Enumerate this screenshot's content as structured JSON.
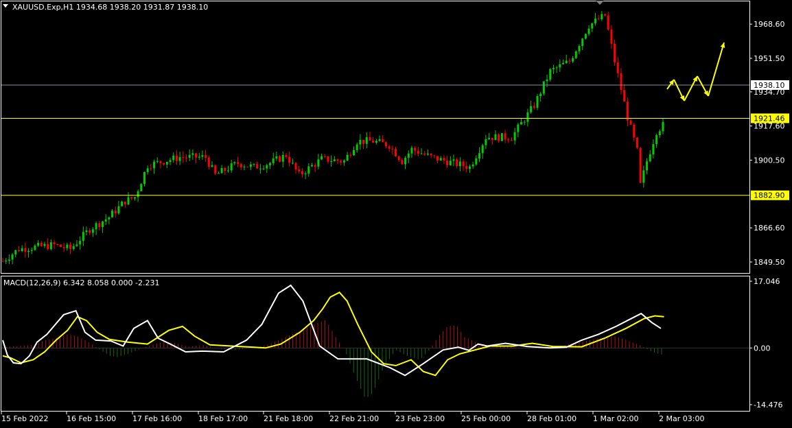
{
  "header": {
    "symbol_line": "XAUUSD.Exp,H1  1934.68 1938.20 1931.87 1938.10"
  },
  "indicator": {
    "label": "MACD(12,26,9) 6.342 8.058 0.000 -2.231"
  },
  "colors": {
    "background": "#000000",
    "frame": "#ffffff",
    "bull": "#00cc00",
    "bear": "#ff0000",
    "level": "#ffff00",
    "price_line": "#8090a0",
    "macd_line": "#ffffff",
    "signal_line": "#ffff00",
    "hist_pos": "#b01010",
    "hist_neg": "#0e6a0e",
    "arrow": "#ffff00"
  },
  "chart_data": {
    "type": "candlestick",
    "price_axis": {
      "ticks": [
        1968.6,
        1951.5,
        1934.7,
        1917.6,
        1900.5,
        1866.6,
        1849.5
      ],
      "tick_labels": [
        "1968.60",
        "1951.50",
        "1934.70",
        "1917.60",
        "1900.50",
        "1866.60",
        "1849.50"
      ],
      "range": [
        1844.0,
        1980.0
      ]
    },
    "current_price": {
      "value": 1938.1,
      "label": "1938.10"
    },
    "horizontal_levels": [
      {
        "value": 1921.46,
        "label": "1921.46"
      },
      {
        "value": 1882.9,
        "label": "1882.90"
      }
    ],
    "time_labels": [
      "15 Feb 2022",
      "16 Feb 15:00",
      "17 Feb 16:00",
      "18 Feb 17:00",
      "21 Feb 18:00",
      "22 Feb 21:00",
      "23 Feb 23:00",
      "25 Feb 00:00",
      "28 Feb 01:00",
      "1 Mar 02:00",
      "2 Mar 03:00"
    ],
    "bar_count": 206,
    "close_anchors": [
      [
        0,
        1850
      ],
      [
        5,
        1856
      ],
      [
        10,
        1857
      ],
      [
        16,
        1858
      ],
      [
        21,
        1856
      ],
      [
        27,
        1866
      ],
      [
        33,
        1872
      ],
      [
        38,
        1880
      ],
      [
        41,
        1882
      ],
      [
        45,
        1898
      ],
      [
        50,
        1900
      ],
      [
        55,
        1902
      ],
      [
        60,
        1902
      ],
      [
        63,
        1902
      ],
      [
        66,
        1893
      ],
      [
        73,
        1899
      ],
      [
        78,
        1897
      ],
      [
        83,
        1899
      ],
      [
        88,
        1903
      ],
      [
        92,
        1893
      ],
      [
        99,
        1901
      ],
      [
        106,
        1900
      ],
      [
        110,
        1910
      ],
      [
        115,
        1910
      ],
      [
        120,
        1908
      ],
      [
        124,
        1900
      ],
      [
        127,
        1906
      ],
      [
        133,
        1902
      ],
      [
        140,
        1899
      ],
      [
        145,
        1897
      ],
      [
        150,
        1912
      ],
      [
        158,
        1912
      ],
      [
        165,
        1928
      ],
      [
        170,
        1945
      ],
      [
        176,
        1950
      ],
      [
        182,
        1968
      ],
      [
        187,
        1973
      ],
      [
        190,
        1950
      ],
      [
        194,
        1922
      ],
      [
        197,
        1905
      ],
      [
        198,
        1888
      ],
      [
        200,
        1900
      ],
      [
        203,
        1915
      ],
      [
        205,
        1918
      ]
    ],
    "macd": {
      "range": [
        -14.476,
        17.046
      ],
      "tick_labels": [
        "17.046",
        "0.00",
        "-14.476"
      ],
      "main_points": [
        [
          0,
          2
        ],
        [
          6,
          -1.8
        ],
        [
          14,
          -3.8
        ],
        [
          24,
          -4
        ],
        [
          35,
          -2
        ],
        [
          45,
          1.5
        ],
        [
          58,
          3.5
        ],
        [
          80,
          8.5
        ],
        [
          96,
          9.5
        ],
        [
          108,
          4
        ],
        [
          122,
          2
        ],
        [
          142,
          1.8
        ],
        [
          158,
          0.5
        ],
        [
          172,
          5
        ],
        [
          190,
          7
        ],
        [
          204,
          2.5
        ],
        [
          220,
          1
        ],
        [
          240,
          -1
        ],
        [
          262,
          -0.8
        ],
        [
          290,
          -1
        ],
        [
          320,
          2
        ],
        [
          340,
          6
        ],
        [
          362,
          14
        ],
        [
          378,
          16
        ],
        [
          394,
          12
        ],
        [
          416,
          0.5
        ],
        [
          440,
          -2.8
        ],
        [
          478,
          -2.8
        ],
        [
          508,
          -5
        ],
        [
          528,
          -7
        ],
        [
          552,
          -4
        ],
        [
          578,
          -0.5
        ],
        [
          598,
          0.2
        ],
        [
          612,
          -0.6
        ],
        [
          624,
          1
        ],
        [
          636,
          0.5
        ],
        [
          660,
          1.2
        ],
        [
          688,
          0.4
        ],
        [
          718,
          0
        ],
        [
          740,
          0.2
        ],
        [
          760,
          2
        ],
        [
          782,
          3.5
        ],
        [
          805,
          5.5
        ],
        [
          822,
          7.2
        ],
        [
          838,
          8.8
        ],
        [
          852,
          6.5
        ],
        [
          864,
          5
        ]
      ],
      "signal_points": [
        [
          0,
          -2
        ],
        [
          10,
          -2.5
        ],
        [
          24,
          -3.8
        ],
        [
          40,
          -3
        ],
        [
          55,
          -1
        ],
        [
          70,
          2
        ],
        [
          85,
          4.5
        ],
        [
          98,
          8
        ],
        [
          110,
          7
        ],
        [
          124,
          4
        ],
        [
          140,
          2.2
        ],
        [
          164,
          1.5
        ],
        [
          190,
          1
        ],
        [
          218,
          4.5
        ],
        [
          236,
          5.5
        ],
        [
          252,
          3
        ],
        [
          272,
          0.8
        ],
        [
          300,
          0.5
        ],
        [
          330,
          0.2
        ],
        [
          345,
          0
        ],
        [
          365,
          1
        ],
        [
          390,
          4
        ],
        [
          408,
          7
        ],
        [
          420,
          10
        ],
        [
          430,
          13
        ],
        [
          442,
          14.2
        ],
        [
          452,
          12
        ],
        [
          466,
          6
        ],
        [
          484,
          -1
        ],
        [
          500,
          -4
        ],
        [
          516,
          -4.5
        ],
        [
          536,
          -3
        ],
        [
          552,
          -6
        ],
        [
          568,
          -7
        ],
        [
          584,
          -3
        ],
        [
          600,
          -1.5
        ],
        [
          620,
          -0.5
        ],
        [
          640,
          0.5
        ],
        [
          670,
          0.5
        ],
        [
          695,
          1.2
        ],
        [
          722,
          0.4
        ],
        [
          760,
          0.3
        ],
        [
          790,
          2.5
        ],
        [
          818,
          5
        ],
        [
          842,
          7.5
        ],
        [
          856,
          8.2
        ],
        [
          868,
          8
        ]
      ],
      "histogram_points": [
        [
          0,
          0.2
        ],
        [
          20,
          0.5
        ],
        [
          40,
          0.8
        ],
        [
          55,
          2
        ],
        [
          70,
          2.5
        ],
        [
          85,
          3.5
        ],
        [
          98,
          3
        ],
        [
          110,
          1.8
        ],
        [
          124,
          0
        ],
        [
          140,
          -2
        ],
        [
          150,
          -2.3
        ],
        [
          165,
          -1.5
        ],
        [
          180,
          -0.3
        ],
        [
          196,
          0.8
        ],
        [
          212,
          1.6
        ],
        [
          228,
          1.2
        ],
        [
          244,
          0.3
        ],
        [
          262,
          0.8
        ],
        [
          280,
          0
        ],
        [
          298,
          -0.6
        ],
        [
          320,
          -0.2
        ],
        [
          344,
          0.6
        ],
        [
          360,
          1.8
        ],
        [
          376,
          3.2
        ],
        [
          392,
          4.5
        ],
        [
          408,
          6
        ],
        [
          424,
          7.2
        ],
        [
          438,
          2.5
        ],
        [
          450,
          -1
        ],
        [
          462,
          -7
        ],
        [
          476,
          -13
        ],
        [
          486,
          -11.5
        ],
        [
          500,
          -5
        ],
        [
          516,
          -0.5
        ],
        [
          530,
          -2
        ],
        [
          548,
          -3
        ],
        [
          560,
          -0.5
        ],
        [
          572,
          3
        ],
        [
          584,
          5.6
        ],
        [
          596,
          5.8
        ],
        [
          606,
          2.8
        ],
        [
          620,
          1.6
        ],
        [
          636,
          0
        ],
        [
          660,
          0.5
        ],
        [
          690,
          -0.2
        ],
        [
          722,
          0
        ],
        [
          744,
          1
        ],
        [
          760,
          1.6
        ],
        [
          782,
          2.5
        ],
        [
          805,
          3
        ],
        [
          822,
          1.8
        ],
        [
          838,
          0.6
        ],
        [
          852,
          -1
        ],
        [
          868,
          -1.8
        ]
      ]
    }
  }
}
